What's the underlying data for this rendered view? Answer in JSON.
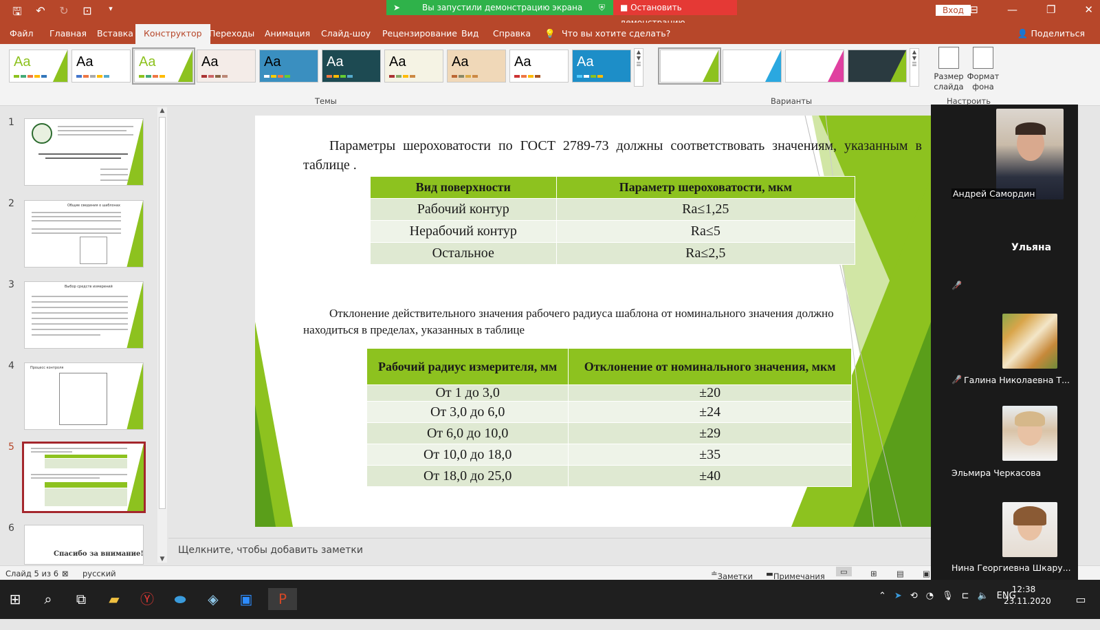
{
  "window": {
    "share_banner": "Вы запустили демонстрацию экрана",
    "stop_share": "Остановить демонстрацию",
    "signin": "Вход"
  },
  "tabs": [
    "Файл",
    "Главная",
    "Вставка",
    "Конструктор",
    "Переходы",
    "Анимация",
    "Слайд-шоу",
    "Рецензирование",
    "Вид",
    "Справка",
    "Что вы хотите сделать?"
  ],
  "share_label": "Поделиться",
  "ribbon": {
    "themes_group": "Темы",
    "variants_group": "Варианты",
    "customize_group": "Настроить",
    "slide_size": "Размер слайда",
    "format_bg": "Формат фона",
    "theme_label": "Aa"
  },
  "thumbnails": {
    "numbers": [
      "1",
      "2",
      "3",
      "4",
      "5",
      "6"
    ],
    "slide2_title": "Общие сведения о шаблонах",
    "slide3_title": "Выбор средств измерений",
    "slide4_title": "Процесс контроля",
    "slide6_text": "Спасибо за внимание!"
  },
  "slide": {
    "para1": "Параметры шероховатости по ГОСТ 2789-73 должны соответствовать значениям, указанным в таблице .",
    "table1": {
      "headers": [
        "Вид поверхности",
        "Параметр шероховатости, мкм"
      ],
      "rows": [
        [
          "Рабочий контур",
          "Ra≤1,25"
        ],
        [
          "Нерабочий контур",
          "Ra≤5"
        ],
        [
          "Остальное",
          "Ra≤2,5"
        ]
      ]
    },
    "para2": "Отклонение действительного значения рабочего радиуса шаблона от номинального значения должно находиться в пределах, указанных в таблице",
    "table2": {
      "headers": [
        "Рабочий радиус измерителя, мм",
        "Отклонение от номинального значения, мкм"
      ],
      "rows": [
        [
          "От 1 до 3,0",
          "±20"
        ],
        [
          "От 3,0 до 6,0",
          "±24"
        ],
        [
          "От 6,0 до 10,0",
          "±29"
        ],
        [
          "От 10,0 до 18,0",
          "±35"
        ],
        [
          "От 18,0 до 25,0",
          "±40"
        ]
      ]
    }
  },
  "notes_placeholder": "Щелкните, чтобы добавить заметки",
  "status": {
    "slide_counter": "Слайд 5 из 6",
    "language": "русский",
    "notes": "Заметки",
    "comments": "Примечания"
  },
  "participants": [
    {
      "name": "Андрей Самордин"
    },
    {
      "name": "Ульяна"
    },
    {
      "name": "Галина Николаевна Т..."
    },
    {
      "name": "Эльмира Черкасова"
    },
    {
      "name": "Нина Георгиевна Шкару..."
    }
  ],
  "taskbar": {
    "lang": "ENG",
    "time": "12:38",
    "date": "23.11.2020"
  },
  "colors": {
    "accent": "#b7472a",
    "green": "#8dc21f"
  }
}
